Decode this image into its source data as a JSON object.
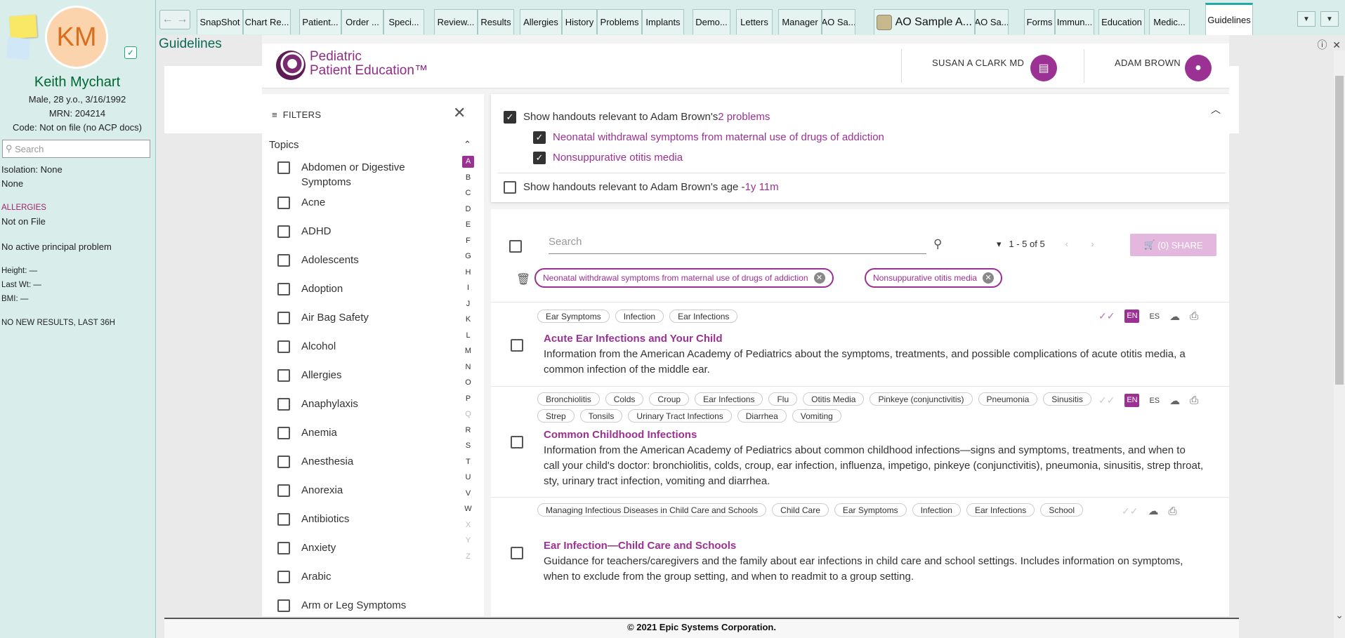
{
  "patient": {
    "initials": "KM",
    "name": "Keith Mychart",
    "demo": "Male, 28 y.o., 3/16/1992",
    "mrn": "MRN: 204214",
    "code": "Code: Not on file (no ACP docs)",
    "search_placeholder": "Search",
    "isolation": "Isolation: None",
    "none": "None",
    "allergies_heading": "ALLERGIES",
    "allergies_value": "Not on File",
    "principal": "No active principal problem",
    "height": "Height: —",
    "lastwt": "Last Wt: —",
    "bmi": "BMI: —",
    "results": "NO NEW RESULTS, LAST 36H"
  },
  "tabs": [
    "SnapShot",
    "Chart Re...",
    "Patient...",
    "Order ...",
    "Speci...",
    "Review...",
    "Results",
    "Allergies",
    "History",
    "Problems",
    "Implants",
    "Demo...",
    "Letters",
    "Manager",
    "AO Sa...",
    "AO Sample A...",
    "AO Sa...",
    "Forms",
    "Immun...",
    "Education",
    "Medic...",
    "Guidelines"
  ],
  "active_tab": "Guidelines",
  "page_title": "Guidelines",
  "footer": "© 2021 Epic Systems Corporation.",
  "app": {
    "logo_line1": "Pediatric",
    "logo_line2": "Patient Education™",
    "provider": "SUSAN A CLARK MD",
    "user": "ADAM BROWN",
    "filters_label": "FILTERS",
    "topics_label": "Topics",
    "topics": [
      "Abdomen or Digestive Symptoms",
      "Acne",
      "ADHD",
      "Adolescents",
      "Adoption",
      "Air Bag Safety",
      "Alcohol",
      "Allergies",
      "Anaphylaxis",
      "Anemia",
      "Anesthesia",
      "Anorexia",
      "Antibiotics",
      "Anxiety",
      "Arabic",
      "Arm or Leg Symptoms"
    ],
    "alphabet": [
      "A",
      "B",
      "C",
      "D",
      "E",
      "F",
      "G",
      "H",
      "I",
      "J",
      "K",
      "L",
      "M",
      "N",
      "O",
      "P",
      "Q",
      "R",
      "S",
      "T",
      "U",
      "V",
      "W",
      "X",
      "Y",
      "Z"
    ],
    "alphabet_disabled": [
      "Q",
      "X",
      "Y",
      "Z"
    ],
    "alphabet_selected": "A",
    "problems_prefix": "Show handouts relevant to Adam Brown's ",
    "problems_count": "2 problems",
    "problem1": "Neonatal withdrawal symptoms from maternal use of drugs of addiction",
    "problem2": "Nonsuppurative otitis media",
    "age_prefix": "Show handouts relevant to Adam Brown's age - ",
    "age_value": "1y 11m",
    "search_placeholder": "Search",
    "pager": "1 - 5 of 5",
    "share": "(0) SHARE",
    "chips": [
      "Neonatal withdrawal symptoms from maternal use of drugs of addiction",
      "Nonsuppurative otitis media"
    ],
    "items": [
      {
        "tags": [
          "Ear Symptoms",
          "Infection",
          "Ear Infections"
        ],
        "title": "Acute Ear Infections and Your Child",
        "desc": "Information from the American Academy of Pediatrics about the symptoms, treatments, and possible complications of acute otitis media, a common infection of the middle ear.",
        "en": "EN",
        "es": "ES"
      },
      {
        "tags": [
          "Bronchiolitis",
          "Colds",
          "Croup",
          "Ear Infections",
          "Flu",
          "Otitis Media",
          "Pinkeye (conjunctivitis)",
          "Pneumonia",
          "Sinusitis",
          "Strep",
          "Tonsils",
          "Urinary Tract Infections",
          "Diarrhea",
          "Vomiting"
        ],
        "title": "Common Childhood Infections",
        "desc": "Information from the American Academy of Pediatrics about common childhood infections—signs and symptoms, treatments, and when to call your child's doctor: bronchiolitis, colds, croup, ear infection, influenza, impetigo, pinkeye (conjunctivitis), pneumonia, sinusitis, strep throat, sty, urinary tract infection, vomiting and diarrhea.",
        "en": "EN",
        "es": "ES"
      },
      {
        "tags": [
          "Managing Infectious Diseases in Child Care and Schools",
          "Child Care",
          "Ear Symptoms",
          "Infection",
          "Ear Infections",
          "School"
        ],
        "title": "Ear Infection—Child Care and Schools",
        "desc": "Guidance for teachers/caregivers and the family about ear infections in child care and school settings. Includes information on symptoms, when to exclude from the group setting, and when to readmit to a group setting."
      }
    ]
  },
  "colors": {
    "accent": "#9b3192",
    "epic_green": "#0a6a55",
    "sidebar_bg": "#d9eeea"
  }
}
